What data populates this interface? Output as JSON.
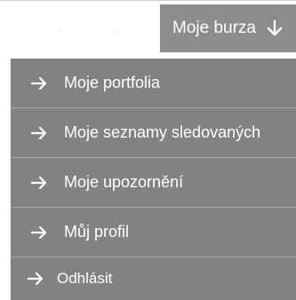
{
  "colors": {
    "toggle_bg": "#8c8c8c",
    "menu_bg": "#828282",
    "separator": "#a3a3a3",
    "text": "#ffffff"
  },
  "toggle": {
    "label": "Moje burza",
    "icon": "arrow-down-icon"
  },
  "menu": {
    "items": [
      {
        "label": "Moje portfolia",
        "icon": "arrow-right-icon"
      },
      {
        "label": "Moje seznamy sledovaných",
        "icon": "arrow-right-icon"
      },
      {
        "label": "Moje upozornění",
        "icon": "arrow-right-icon"
      },
      {
        "label": "Můj profil",
        "icon": "arrow-right-icon"
      },
      {
        "label": "Odhlásit",
        "icon": "arrow-right-icon"
      }
    ]
  }
}
